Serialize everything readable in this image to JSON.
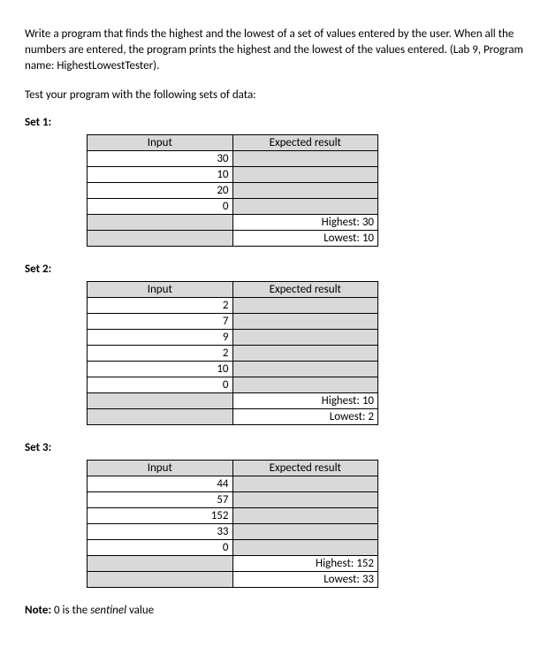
{
  "para1": "Write a program that finds the highest and the lowest of a set of values entered by the user. When all the numbers are entered, the program prints the highest and the lowest of the values entered. (Lab 9, Program name: HighestLowestTester).",
  "para2": "Test your program with the following sets of data:",
  "col_input": "Input",
  "col_expected": "Expected result",
  "sets": [
    {
      "label": "Set 1:",
      "inputs": [
        "30",
        "10",
        "20",
        "0"
      ],
      "results": [
        "Highest: 30",
        "Lowest: 10"
      ]
    },
    {
      "label": "Set 2:",
      "inputs": [
        "2",
        "7",
        "9",
        "2",
        "10",
        "0"
      ],
      "results": [
        "Highest: 10",
        "Lowest: 2"
      ]
    },
    {
      "label": "Set 3:",
      "inputs": [
        "44",
        "57",
        "152",
        "33",
        "0"
      ],
      "results": [
        "Highest: 152",
        "Lowest: 33"
      ]
    }
  ],
  "note_prefix": "Note:",
  "note_mid": " 0 is the ",
  "note_italic": "sentinel",
  "note_suffix": " value"
}
